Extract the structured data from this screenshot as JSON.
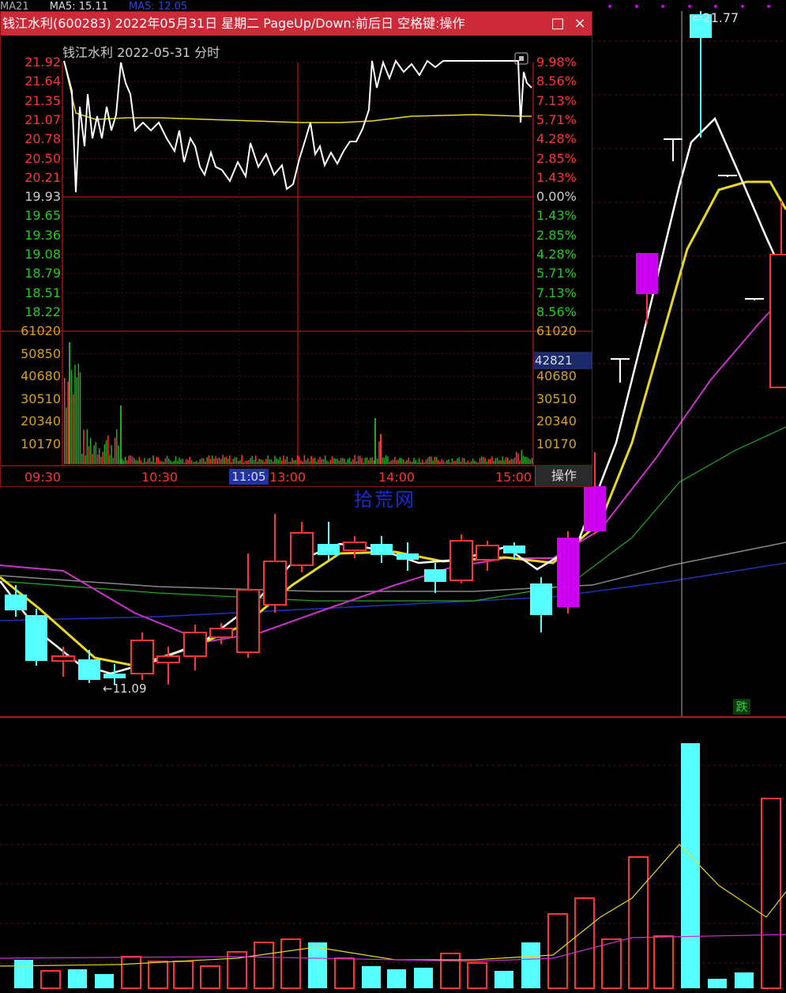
{
  "main_chart": {
    "ma_top_labels": [
      "MA21",
      "MA5: 15.11",
      "MA5: 12.05"
    ],
    "high_marker": "21.77",
    "low_marker": "11.09",
    "die_badge": "跌",
    "watermark": "拾荒网",
    "colors": {
      "up": "#ff3333",
      "down": "#55ffff",
      "limit": "#cc00ee",
      "ma5": "#ffffff",
      "ma10": "#e8d820",
      "ma20": "#cc33cc",
      "ma30": "#22aa22",
      "ma60": "#888888",
      "ma120": "#2233bb"
    }
  },
  "popup": {
    "title": "钱江水利(600283) 2022年05月31日 星期二 PageUp/Down:前后日 空格键:操作",
    "subtitle": "钱江水利   2022-05-31  分时",
    "price_labels": [
      "21.92",
      "21.64",
      "21.35",
      "21.07",
      "20.78",
      "20.50",
      "20.21",
      "19.93",
      "19.65",
      "19.36",
      "19.08",
      "18.79",
      "18.51",
      "18.22"
    ],
    "pct_labels": [
      "9.98%",
      "8.56%",
      "7.13%",
      "5.71%",
      "4.28%",
      "2.85%",
      "1.43%",
      "0.00%",
      "1.43%",
      "2.85%",
      "4.28%",
      "5.71%",
      "7.13%",
      "8.56%"
    ],
    "vol_labels_left": [
      "61020",
      "50850",
      "40680",
      "30510",
      "20340",
      "10170"
    ],
    "vol_labels_right": [
      "61020",
      "50850",
      "40680",
      "30510",
      "20340",
      "10170"
    ],
    "vol_readout": "42821",
    "time_labels": [
      "09:30",
      "10:30",
      "13:00",
      "14:00",
      "15:00"
    ],
    "time_cursor": "11:05",
    "op_button": "操作",
    "close_icon": "×",
    "max_icon": "□"
  }
}
